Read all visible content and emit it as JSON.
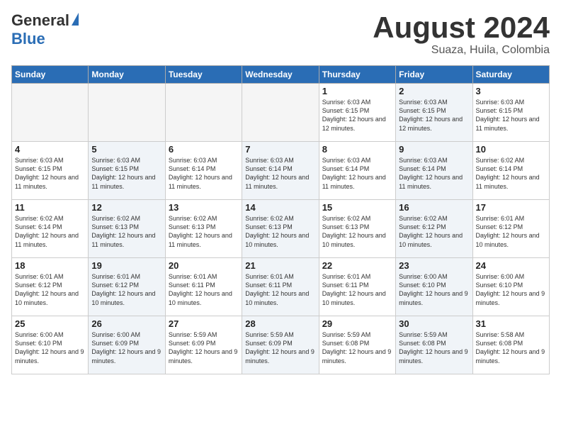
{
  "header": {
    "logo_general": "General",
    "logo_blue": "Blue",
    "title": "August 2024",
    "location": "Suaza, Huila, Colombia"
  },
  "days_of_week": [
    "Sunday",
    "Monday",
    "Tuesday",
    "Wednesday",
    "Thursday",
    "Friday",
    "Saturday"
  ],
  "weeks": [
    [
      {
        "day": "",
        "info": "",
        "empty": true
      },
      {
        "day": "",
        "info": "",
        "empty": true
      },
      {
        "day": "",
        "info": "",
        "empty": true
      },
      {
        "day": "",
        "info": "",
        "empty": true
      },
      {
        "day": "1",
        "info": "Sunrise: 6:03 AM\nSunset: 6:15 PM\nDaylight: 12 hours\nand 12 minutes.",
        "empty": false,
        "alt": false
      },
      {
        "day": "2",
        "info": "Sunrise: 6:03 AM\nSunset: 6:15 PM\nDaylight: 12 hours\nand 12 minutes.",
        "empty": false,
        "alt": true
      },
      {
        "day": "3",
        "info": "Sunrise: 6:03 AM\nSunset: 6:15 PM\nDaylight: 12 hours\nand 11 minutes.",
        "empty": false,
        "alt": false
      }
    ],
    [
      {
        "day": "4",
        "info": "Sunrise: 6:03 AM\nSunset: 6:15 PM\nDaylight: 12 hours\nand 11 minutes.",
        "empty": false,
        "alt": false
      },
      {
        "day": "5",
        "info": "Sunrise: 6:03 AM\nSunset: 6:15 PM\nDaylight: 12 hours\nand 11 minutes.",
        "empty": false,
        "alt": true
      },
      {
        "day": "6",
        "info": "Sunrise: 6:03 AM\nSunset: 6:14 PM\nDaylight: 12 hours\nand 11 minutes.",
        "empty": false,
        "alt": false
      },
      {
        "day": "7",
        "info": "Sunrise: 6:03 AM\nSunset: 6:14 PM\nDaylight: 12 hours\nand 11 minutes.",
        "empty": false,
        "alt": true
      },
      {
        "day": "8",
        "info": "Sunrise: 6:03 AM\nSunset: 6:14 PM\nDaylight: 12 hours\nand 11 minutes.",
        "empty": false,
        "alt": false
      },
      {
        "day": "9",
        "info": "Sunrise: 6:03 AM\nSunset: 6:14 PM\nDaylight: 12 hours\nand 11 minutes.",
        "empty": false,
        "alt": true
      },
      {
        "day": "10",
        "info": "Sunrise: 6:02 AM\nSunset: 6:14 PM\nDaylight: 12 hours\nand 11 minutes.",
        "empty": false,
        "alt": false
      }
    ],
    [
      {
        "day": "11",
        "info": "Sunrise: 6:02 AM\nSunset: 6:14 PM\nDaylight: 12 hours\nand 11 minutes.",
        "empty": false,
        "alt": false
      },
      {
        "day": "12",
        "info": "Sunrise: 6:02 AM\nSunset: 6:13 PM\nDaylight: 12 hours\nand 11 minutes.",
        "empty": false,
        "alt": true
      },
      {
        "day": "13",
        "info": "Sunrise: 6:02 AM\nSunset: 6:13 PM\nDaylight: 12 hours\nand 11 minutes.",
        "empty": false,
        "alt": false
      },
      {
        "day": "14",
        "info": "Sunrise: 6:02 AM\nSunset: 6:13 PM\nDaylight: 12 hours\nand 10 minutes.",
        "empty": false,
        "alt": true
      },
      {
        "day": "15",
        "info": "Sunrise: 6:02 AM\nSunset: 6:13 PM\nDaylight: 12 hours\nand 10 minutes.",
        "empty": false,
        "alt": false
      },
      {
        "day": "16",
        "info": "Sunrise: 6:02 AM\nSunset: 6:12 PM\nDaylight: 12 hours\nand 10 minutes.",
        "empty": false,
        "alt": true
      },
      {
        "day": "17",
        "info": "Sunrise: 6:01 AM\nSunset: 6:12 PM\nDaylight: 12 hours\nand 10 minutes.",
        "empty": false,
        "alt": false
      }
    ],
    [
      {
        "day": "18",
        "info": "Sunrise: 6:01 AM\nSunset: 6:12 PM\nDaylight: 12 hours\nand 10 minutes.",
        "empty": false,
        "alt": false
      },
      {
        "day": "19",
        "info": "Sunrise: 6:01 AM\nSunset: 6:12 PM\nDaylight: 12 hours\nand 10 minutes.",
        "empty": false,
        "alt": true
      },
      {
        "day": "20",
        "info": "Sunrise: 6:01 AM\nSunset: 6:11 PM\nDaylight: 12 hours\nand 10 minutes.",
        "empty": false,
        "alt": false
      },
      {
        "day": "21",
        "info": "Sunrise: 6:01 AM\nSunset: 6:11 PM\nDaylight: 12 hours\nand 10 minutes.",
        "empty": false,
        "alt": true
      },
      {
        "day": "22",
        "info": "Sunrise: 6:01 AM\nSunset: 6:11 PM\nDaylight: 12 hours\nand 10 minutes.",
        "empty": false,
        "alt": false
      },
      {
        "day": "23",
        "info": "Sunrise: 6:00 AM\nSunset: 6:10 PM\nDaylight: 12 hours\nand 9 minutes.",
        "empty": false,
        "alt": true
      },
      {
        "day": "24",
        "info": "Sunrise: 6:00 AM\nSunset: 6:10 PM\nDaylight: 12 hours\nand 9 minutes.",
        "empty": false,
        "alt": false
      }
    ],
    [
      {
        "day": "25",
        "info": "Sunrise: 6:00 AM\nSunset: 6:10 PM\nDaylight: 12 hours\nand 9 minutes.",
        "empty": false,
        "alt": false
      },
      {
        "day": "26",
        "info": "Sunrise: 6:00 AM\nSunset: 6:09 PM\nDaylight: 12 hours\nand 9 minutes.",
        "empty": false,
        "alt": true
      },
      {
        "day": "27",
        "info": "Sunrise: 5:59 AM\nSunset: 6:09 PM\nDaylight: 12 hours\nand 9 minutes.",
        "empty": false,
        "alt": false
      },
      {
        "day": "28",
        "info": "Sunrise: 5:59 AM\nSunset: 6:09 PM\nDaylight: 12 hours\nand 9 minutes.",
        "empty": false,
        "alt": true
      },
      {
        "day": "29",
        "info": "Sunrise: 5:59 AM\nSunset: 6:08 PM\nDaylight: 12 hours\nand 9 minutes.",
        "empty": false,
        "alt": false
      },
      {
        "day": "30",
        "info": "Sunrise: 5:59 AM\nSunset: 6:08 PM\nDaylight: 12 hours\nand 9 minutes.",
        "empty": false,
        "alt": true
      },
      {
        "day": "31",
        "info": "Sunrise: 5:58 AM\nSunset: 6:08 PM\nDaylight: 12 hours\nand 9 minutes.",
        "empty": false,
        "alt": false
      }
    ]
  ]
}
